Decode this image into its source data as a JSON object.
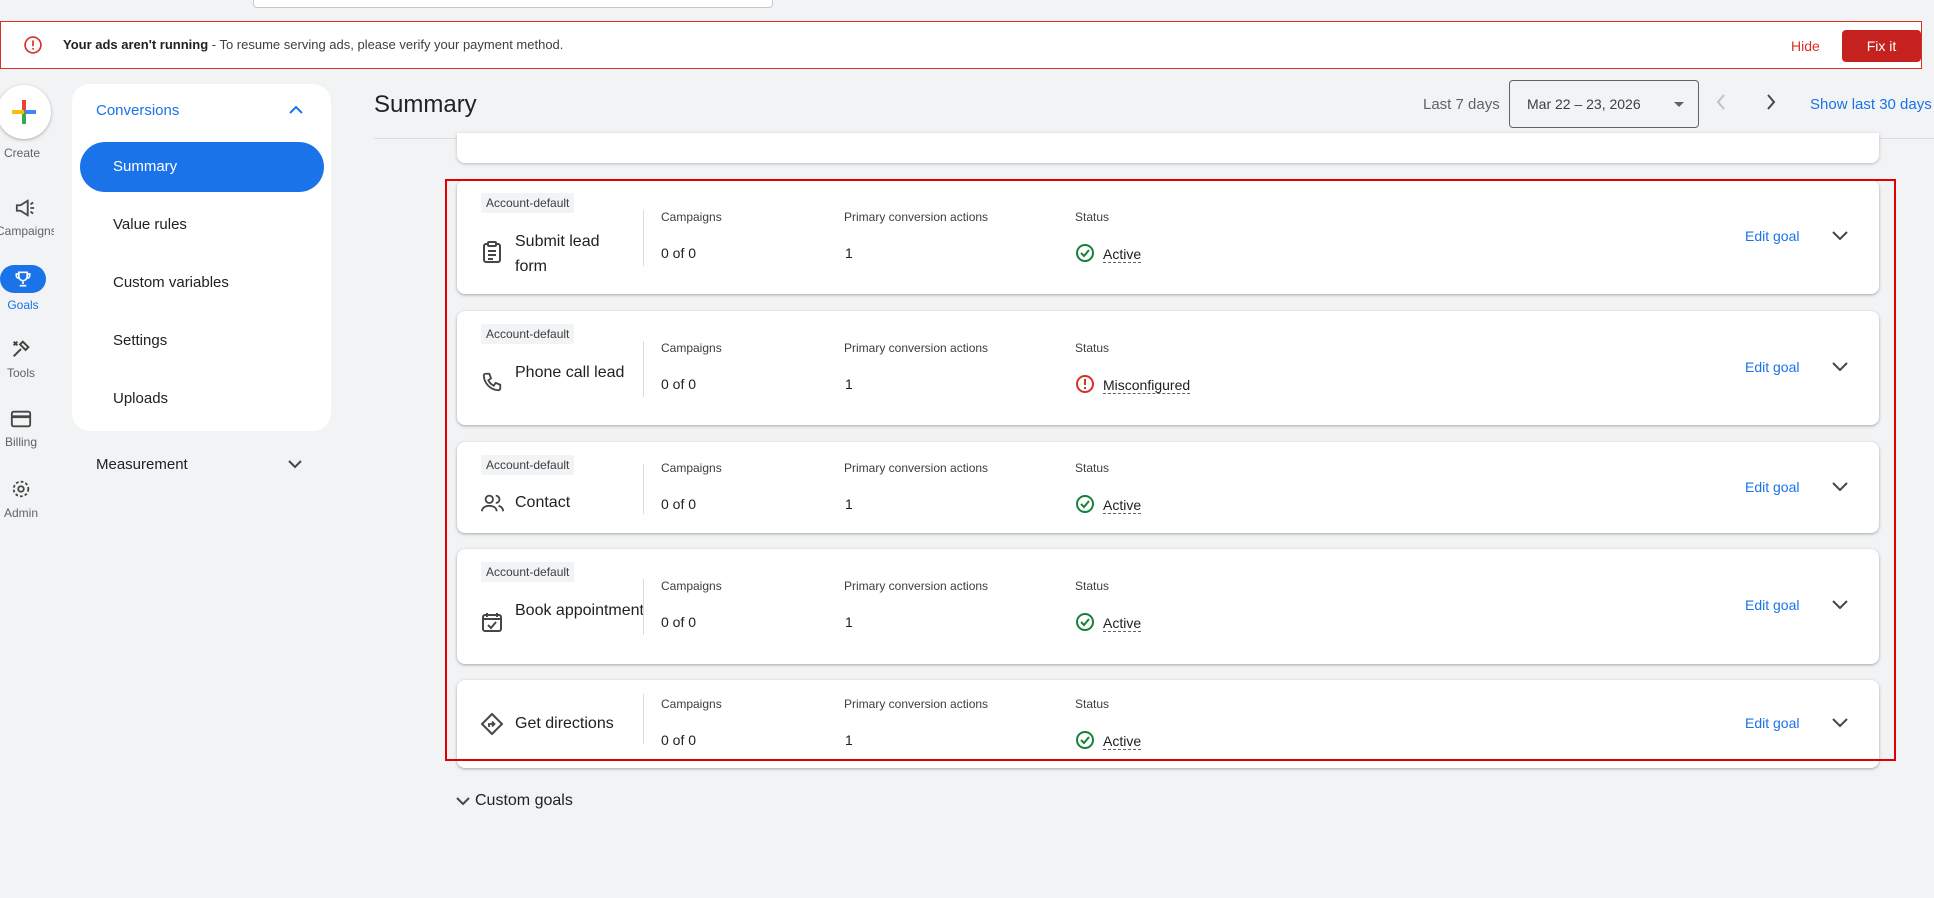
{
  "banner": {
    "title": "Your ads aren't running",
    "message": " - To resume serving ads, please verify your payment method.",
    "hide_label": "Hide",
    "fix_label": "Fix it"
  },
  "rail": {
    "create": "Create",
    "campaigns": "Campaigns",
    "goals": "Goals",
    "tools": "Tools",
    "billing": "Billing",
    "admin": "Admin"
  },
  "subnav": {
    "section": "Conversions",
    "items": [
      "Summary",
      "Value rules",
      "Custom variables",
      "Settings",
      "Uploads"
    ],
    "measurement": "Measurement"
  },
  "header": {
    "title": "Summary",
    "range_label": "Last 7 days",
    "date_range": "Mar 22 – 23, 2026",
    "show_last": "Show last 30 days"
  },
  "columns": {
    "campaigns": "Campaigns",
    "primary": "Primary conversion actions",
    "status": "Status"
  },
  "goals": [
    {
      "badge": "Account-default",
      "name": "Submit lead form",
      "icon": "clipboard-icon",
      "campaigns": "0 of 0",
      "primary": "1",
      "status": "Active",
      "edit": "Edit goal"
    },
    {
      "badge": "Account-default",
      "name": "Phone call lead",
      "icon": "phone-icon",
      "campaigns": "0 of 0",
      "primary": "1",
      "status": "Misconfigured",
      "edit": "Edit goal"
    },
    {
      "badge": "Account-default",
      "name": "Contact",
      "icon": "people-icon",
      "campaigns": "0 of 0",
      "primary": "1",
      "status": "Active",
      "edit": "Edit goal"
    },
    {
      "badge": "Account-default",
      "name": "Book appointment",
      "icon": "calendar-check-icon",
      "campaigns": "0 of 0",
      "primary": "1",
      "status": "Active",
      "edit": "Edit goal"
    },
    {
      "badge": "",
      "name": "Get directions",
      "icon": "directions-icon",
      "campaigns": "0 of 0",
      "primary": "1",
      "status": "Active",
      "edit": "Edit goal"
    }
  ],
  "custom_goals": "Custom goals",
  "colors": {
    "accent": "#1a73e8",
    "error": "#d93025",
    "fix_button": "#c5221f",
    "success": "#188038"
  }
}
